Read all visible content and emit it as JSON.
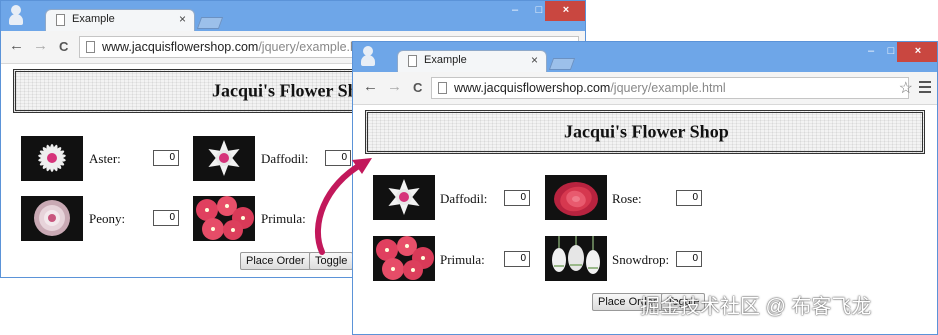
{
  "windows": {
    "back": {
      "tab_title": "Example",
      "tab_close": "×",
      "url_host": "www.jacquisflowershop.com",
      "url_path": "/jquery/example.html",
      "title": "Jacqui's Flower Shop",
      "flowers": [
        {
          "label": "Aster:",
          "value": "0",
          "image": "aster"
        },
        {
          "label": "Daffodil:",
          "value": "0",
          "image": "daffodil"
        },
        {
          "label": "Peony:",
          "value": "0",
          "image": "peony"
        },
        {
          "label": "Primula:",
          "value": "0",
          "image": "primula"
        }
      ],
      "buttons": {
        "place_order": "Place Order",
        "toggle": "Toggle"
      }
    },
    "front": {
      "tab_title": "Example",
      "tab_close": "×",
      "url_host": "www.jacquisflowershop.com",
      "url_path": "/jquery/example.html",
      "title": "Jacqui's Flower Shop",
      "flowers": [
        {
          "label": "Daffodil:",
          "value": "0",
          "image": "daffodil"
        },
        {
          "label": "Rose:",
          "value": "0",
          "image": "rose"
        },
        {
          "label": "Primula:",
          "value": "0",
          "image": "primula"
        },
        {
          "label": "Snowdrop:",
          "value": "0",
          "image": "snowdrop"
        }
      ],
      "buttons": {
        "place_order": "Place Order",
        "toggle": "Toggle"
      }
    }
  },
  "chrome": {
    "back": "←",
    "forward": "→",
    "reload": "C",
    "star": "☆",
    "minimize": "–",
    "maximize": "□",
    "close": "×"
  },
  "colors": {
    "titlebar": "#6ea6e8",
    "close_button": "#c94740",
    "arrow": "#c2185b"
  },
  "watermark": "掘金技术社区 @ 布客飞龙"
}
